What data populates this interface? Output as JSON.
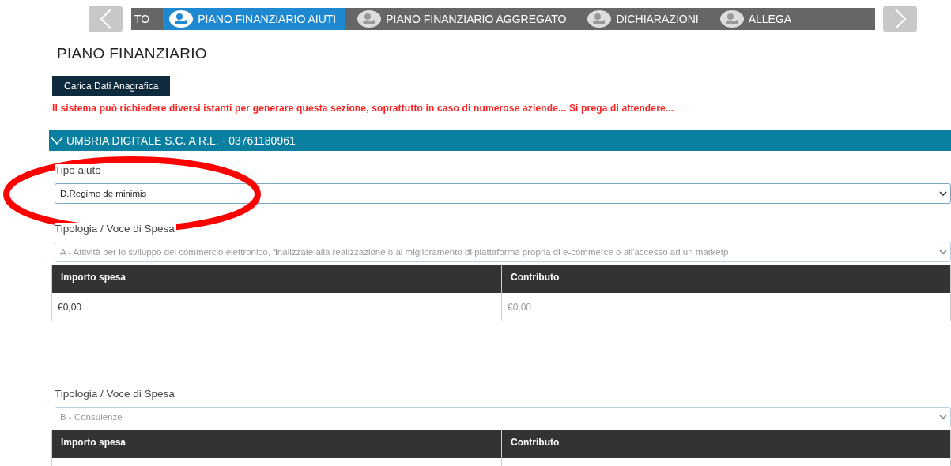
{
  "stepper": {
    "steps": [
      {
        "kind": "partial",
        "label": "TO",
        "selected": false
      },
      {
        "kind": "step",
        "label": "PIANO FINANZIARIO AIUTI",
        "selected": true
      },
      {
        "kind": "step",
        "label": "PIANO FINANZIARIO AGGREGATO",
        "selected": false
      },
      {
        "kind": "step",
        "label": "DICHIARAZIONI",
        "selected": false
      },
      {
        "kind": "step",
        "label": "ALLEGA",
        "selected": false
      }
    ]
  },
  "page_title": "PIANO FINANZIARIO",
  "load_button": "Carica Dati Anagrafica",
  "warning": "Il sistema può richiedere diversi istanti per generare questa sezione, soprattutto in caso di numerose aziende... Si prega di attendere...",
  "company": {
    "title": "UMBRIA DIGITALE S.C. A R.L. - 03761180961",
    "expanded": true
  },
  "tipo_aiuto": {
    "label": "Tipo aiuto",
    "value": "D.Regime de minimis",
    "disabled": false
  },
  "spese": [
    {
      "label": "Tipologia / Voce di Spesa",
      "value": "A - Attività per lo sviluppo del commercio elettronico, finalizzate alla realizzazione o al miglioramento di piattaforma propria di e-commerce o all'accesso ad un marketp",
      "disabled": true,
      "columns": [
        "Importo spesa",
        "Contributo"
      ],
      "rows": [
        {
          "importo": "€0,00",
          "contributo": "€0,00"
        }
      ]
    },
    {
      "label": "Tipologia / Voce di Spesa",
      "value": "B - Consulenze",
      "disabled": true,
      "columns": [
        "Importo spesa",
        "Contributo"
      ]
    }
  ],
  "highlight": {
    "kind": "ellipse"
  }
}
